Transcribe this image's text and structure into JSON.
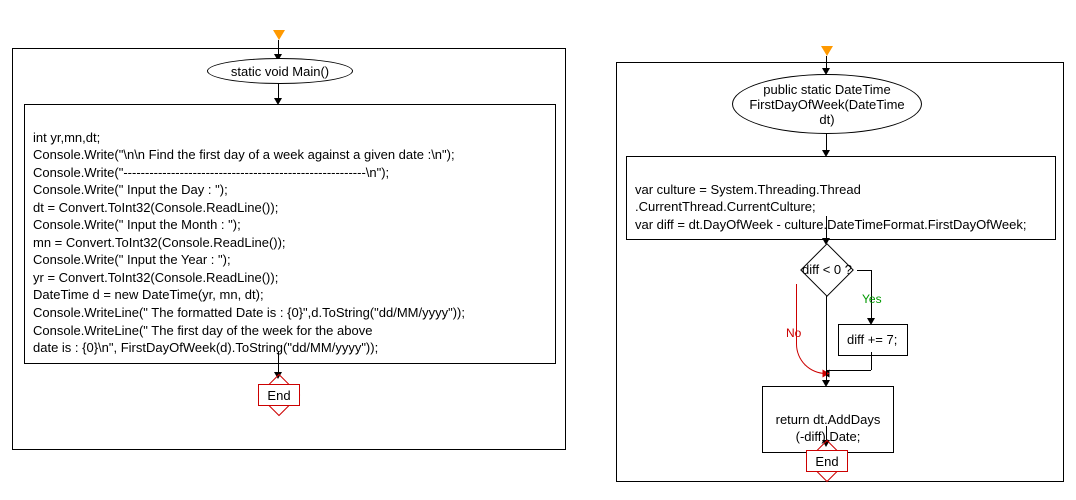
{
  "left": {
    "entry_label": "static void Main()",
    "code": "int yr,mn,dt;\nConsole.Write(\"\\n\\n Find the first day of a week against a given date :\\n\");\nConsole.Write(\"--------------------------------------------------------\\n\");\nConsole.Write(\" Input the Day : \");\ndt = Convert.ToInt32(Console.ReadLine());\nConsole.Write(\" Input the Month : \");\nmn = Convert.ToInt32(Console.ReadLine());\nConsole.Write(\" Input the Year : \");\nyr = Convert.ToInt32(Console.ReadLine());\nDateTime d = new DateTime(yr, mn, dt);\nConsole.WriteLine(\" The formatted Date is : {0}\",d.ToString(\"dd/MM/yyyy\"));\nConsole.WriteLine(\" The first day of the week for the above\ndate is : {0}\\n\", FirstDayOfWeek(d).ToString(\"dd/MM/yyyy\"));",
    "end_label": "End"
  },
  "right": {
    "entry_label": "public static DateTime\nFirstDayOfWeek(DateTime\ndt)",
    "block1": "var culture = System.Threading.Thread\n.CurrentThread.CurrentCulture;\nvar diff = dt.DayOfWeek - culture.DateTimeFormat.FirstDayOfWeek;",
    "decision": "diff < 0 ?",
    "decision_yes": "Yes",
    "decision_no": "No",
    "yes_block": "diff += 7;",
    "return_block": "return dt.AddDays\n(-diff).Date;",
    "end_label": "End"
  }
}
